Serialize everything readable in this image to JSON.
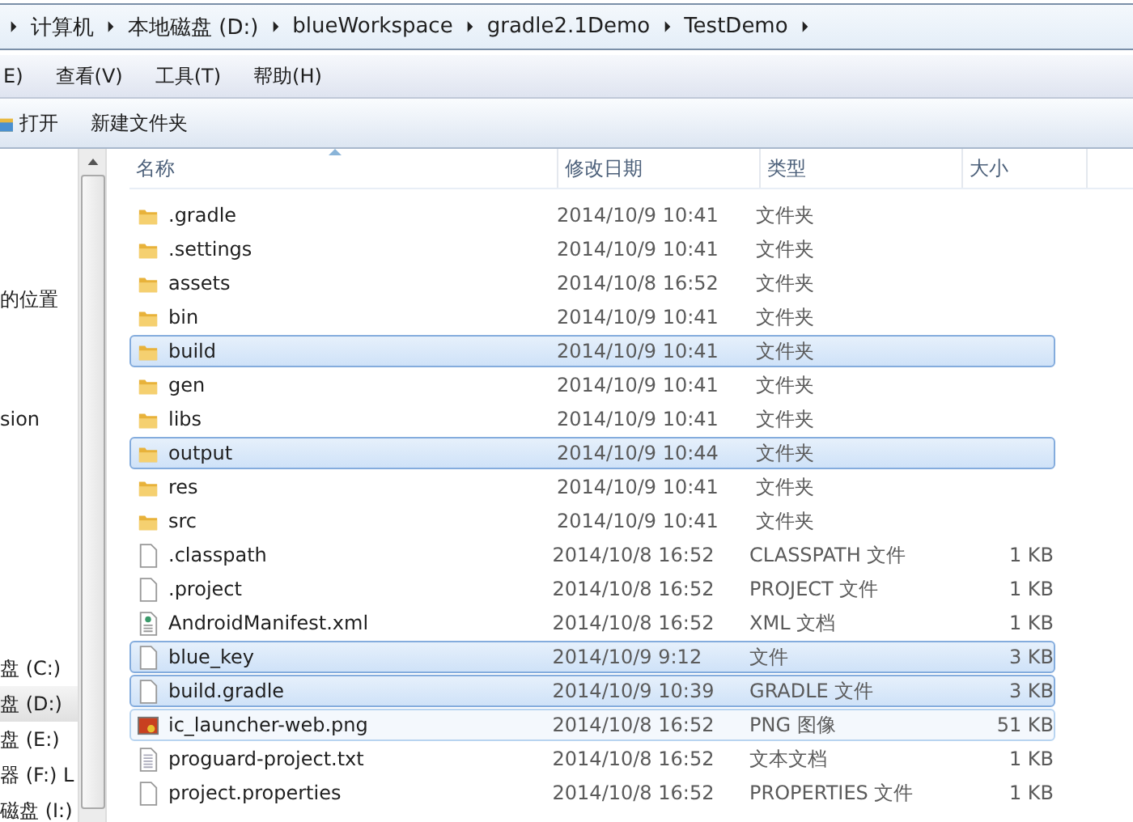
{
  "breadcrumb": [
    "计算机",
    "本地磁盘 (D:)",
    "blueWorkspace",
    "gradle2.1Demo",
    "TestDemo"
  ],
  "menu": [
    "E)",
    "查看(V)",
    "工具(T)",
    "帮助(H)"
  ],
  "toolbar": [
    {
      "label": "打开",
      "kind": "open"
    },
    {
      "label": "新建文件夹",
      "kind": "plain"
    }
  ],
  "sidebar": {
    "items": [
      {
        "label": "的位置",
        "selected": false
      },
      {
        "label": "sion",
        "selected": false
      }
    ],
    "drives": [
      {
        "label": "盘 (C:)",
        "selected": false
      },
      {
        "label": "盘 (D:)",
        "selected": true
      },
      {
        "label": "盘 (E:)",
        "selected": false
      },
      {
        "label": "器 (F:) L",
        "selected": false
      },
      {
        "label": "磁盘 (I:)",
        "selected": false
      }
    ]
  },
  "table": {
    "columns": [
      "名称",
      "修改日期",
      "类型",
      "大小"
    ],
    "rows": [
      {
        "name": ".gradle",
        "date": "2014/10/9 10:41",
        "type": "文件夹",
        "size": "",
        "kind": "folder",
        "selected": false,
        "hovered": false
      },
      {
        "name": ".settings",
        "date": "2014/10/9 10:41",
        "type": "文件夹",
        "size": "",
        "kind": "folder",
        "selected": false,
        "hovered": false
      },
      {
        "name": "assets",
        "date": "2014/10/8 16:52",
        "type": "文件夹",
        "size": "",
        "kind": "folder",
        "selected": false,
        "hovered": false
      },
      {
        "name": "bin",
        "date": "2014/10/9 10:41",
        "type": "文件夹",
        "size": "",
        "kind": "folder",
        "selected": false,
        "hovered": false
      },
      {
        "name": "build",
        "date": "2014/10/9 10:41",
        "type": "文件夹",
        "size": "",
        "kind": "folder",
        "selected": true,
        "hovered": false
      },
      {
        "name": "gen",
        "date": "2014/10/9 10:41",
        "type": "文件夹",
        "size": "",
        "kind": "folder",
        "selected": false,
        "hovered": false
      },
      {
        "name": "libs",
        "date": "2014/10/9 10:41",
        "type": "文件夹",
        "size": "",
        "kind": "folder",
        "selected": false,
        "hovered": false
      },
      {
        "name": "output",
        "date": "2014/10/9 10:44",
        "type": "文件夹",
        "size": "",
        "kind": "folder",
        "selected": true,
        "hovered": false
      },
      {
        "name": "res",
        "date": "2014/10/9 10:41",
        "type": "文件夹",
        "size": "",
        "kind": "folder",
        "selected": false,
        "hovered": false
      },
      {
        "name": "src",
        "date": "2014/10/9 10:41",
        "type": "文件夹",
        "size": "",
        "kind": "folder",
        "selected": false,
        "hovered": false
      },
      {
        "name": ".classpath",
        "date": "2014/10/8 16:52",
        "type": "CLASSPATH 文件",
        "size": "1 KB",
        "kind": "file",
        "selected": false,
        "hovered": false
      },
      {
        "name": ".project",
        "date": "2014/10/8 16:52",
        "type": "PROJECT 文件",
        "size": "1 KB",
        "kind": "file",
        "selected": false,
        "hovered": false
      },
      {
        "name": "AndroidManifest.xml",
        "date": "2014/10/8 16:52",
        "type": "XML 文档",
        "size": "1 KB",
        "kind": "xml",
        "selected": false,
        "hovered": false
      },
      {
        "name": "blue_key",
        "date": "2014/10/9 9:12",
        "type": "文件",
        "size": "3 KB",
        "kind": "file",
        "selected": true,
        "hovered": false
      },
      {
        "name": "build.gradle",
        "date": "2014/10/9 10:39",
        "type": "GRADLE 文件",
        "size": "3 KB",
        "kind": "file",
        "selected": true,
        "hovered": false
      },
      {
        "name": "ic_launcher-web.png",
        "date": "2014/10/8 16:52",
        "type": "PNG 图像",
        "size": "51 KB",
        "kind": "image",
        "selected": false,
        "hovered": true
      },
      {
        "name": "proguard-project.txt",
        "date": "2014/10/8 16:52",
        "type": "文本文档",
        "size": "1 KB",
        "kind": "text",
        "selected": false,
        "hovered": false
      },
      {
        "name": "project.properties",
        "date": "2014/10/8 16:52",
        "type": "PROPERTIES 文件",
        "size": "1 KB",
        "kind": "file",
        "selected": false,
        "hovered": false
      }
    ]
  }
}
